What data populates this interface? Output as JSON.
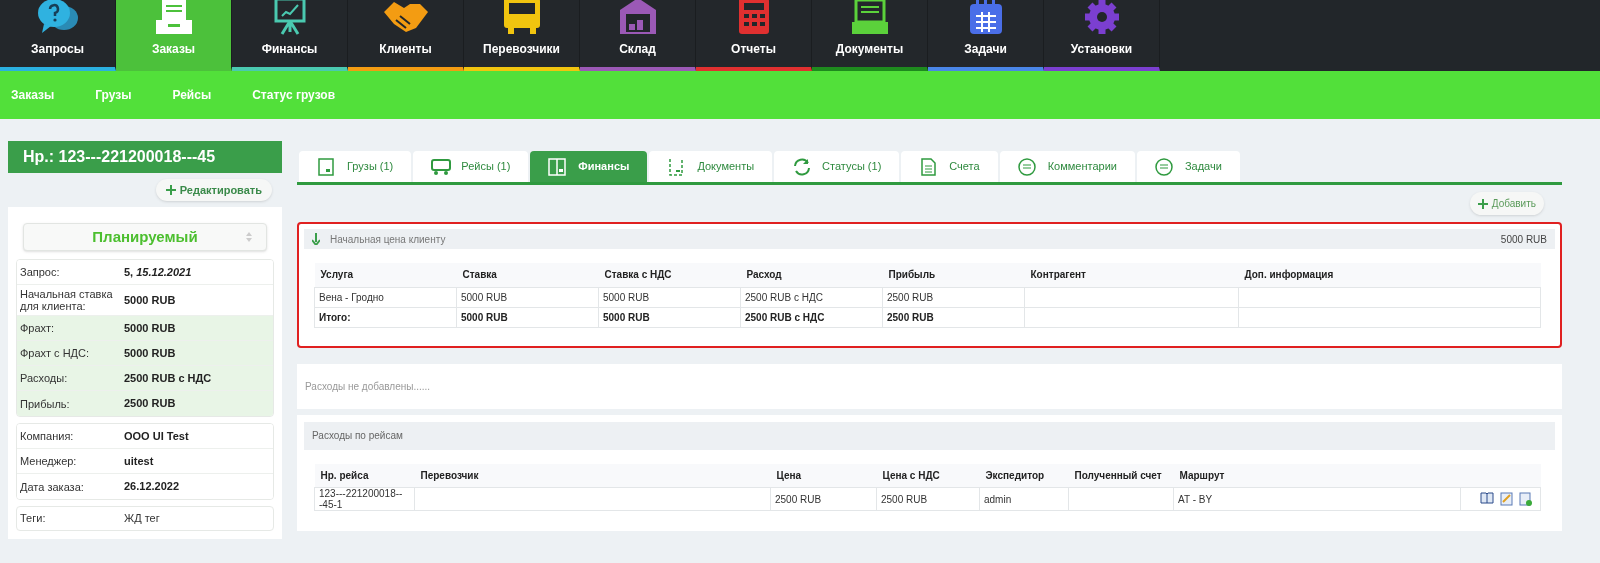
{
  "top_nav": [
    {
      "label": "Запросы",
      "selected": false,
      "color": "#2bb0e0"
    },
    {
      "label": "Заказы",
      "selected": true,
      "color": "#4cc13b"
    },
    {
      "label": "Финансы",
      "selected": false,
      "color": "#4ac9b0"
    },
    {
      "label": "Клиенты",
      "selected": false,
      "color": "#f39c12"
    },
    {
      "label": "Перевозчики",
      "selected": false,
      "color": "#f1c40f"
    },
    {
      "label": "Склад",
      "selected": false,
      "color": "#9b59b6"
    },
    {
      "label": "Отчеты",
      "selected": false,
      "color": "#e03030"
    },
    {
      "label": "Документы",
      "selected": false,
      "color": "#1e8a1e"
    },
    {
      "label": "Задачи",
      "selected": false,
      "color": "#4a86e8"
    },
    {
      "label": "Установки",
      "selected": false,
      "color": "#7b3fd0"
    }
  ],
  "sub_nav": [
    "Заказы",
    "Грузы",
    "Рейсы",
    "Статус грузов"
  ],
  "order": {
    "title": "Нр.: 123---221200018---45",
    "edit_button": "Редактировать",
    "status": "Планируемый",
    "info_groups": [
      [
        {
          "label": "Запрос:",
          "value": "5, *15.12.2021*",
          "highlighted": false
        },
        {
          "label": "Начальная ставка для клиента:",
          "value": "5000 RUB",
          "highlighted": false
        },
        {
          "label": "Фрахт:",
          "value": "5000 RUB",
          "highlighted": true
        },
        {
          "label": "Фрахт с НДС:",
          "value": "5000 RUB",
          "highlighted": true
        },
        {
          "label": "Расходы:",
          "value": "2500 RUB с НДС",
          "highlighted": true
        },
        {
          "label": "Прибыль:",
          "value": "2500 RUB",
          "highlighted": true
        }
      ],
      [
        {
          "label": "Компания:",
          "value": "ООО UI Test",
          "highlighted": false
        },
        {
          "label": "Менеджер:",
          "value": "uitest",
          "highlighted": false
        },
        {
          "label": "Дата заказа:",
          "value": "26.12.2022",
          "highlighted": false
        }
      ]
    ],
    "tags": {
      "label": "Теги:",
      "value": "ЖД тег"
    }
  },
  "tabs": [
    {
      "label": "Грузы (1)",
      "selected": false
    },
    {
      "label": "Рейсы (1)",
      "selected": false
    },
    {
      "label": "Финансы",
      "selected": true
    },
    {
      "label": "Документы",
      "selected": false
    },
    {
      "label": "Статусы (1)",
      "selected": false
    },
    {
      "label": "Счета",
      "selected": false
    },
    {
      "label": "Комментарии",
      "selected": false
    },
    {
      "label": "Задачи",
      "selected": false
    }
  ],
  "add_button": "Добавить",
  "client_price": {
    "title": "Начальная цена клиенту",
    "amount": "5000 RUB",
    "columns": [
      "Услуга",
      "Ставка",
      "Ставка с НДС",
      "Расход",
      "Прибыль",
      "Контрагент",
      "Доп. информация"
    ],
    "rows": [
      {
        "kind": "item",
        "cells": [
          "Вена - Гродно",
          "5000 RUB",
          "5000 RUB",
          "2500 RUB с НДС",
          "2500 RUB",
          "",
          ""
        ]
      },
      {
        "kind": "total",
        "cells": [
          "Итого:",
          "5000 RUB",
          "5000 RUB",
          "2500 RUB с НДС",
          "2500 RUB",
          "",
          ""
        ]
      }
    ]
  },
  "expenses_note": "Расходы не добавлены......",
  "trip_expenses": {
    "title": "Расходы по рейсам",
    "columns": [
      "Нр. рейса",
      "Перевозчик",
      "Цена",
      "Цена с НДС",
      "Экспедитор",
      "Полученный счет",
      "Маршрут"
    ],
    "rows": [
      {
        "cells": [
          "123---221200018---45-1",
          "",
          "2500 RUB",
          "2500 RUB",
          "admin",
          "",
          "AT - BY"
        ]
      }
    ]
  }
}
